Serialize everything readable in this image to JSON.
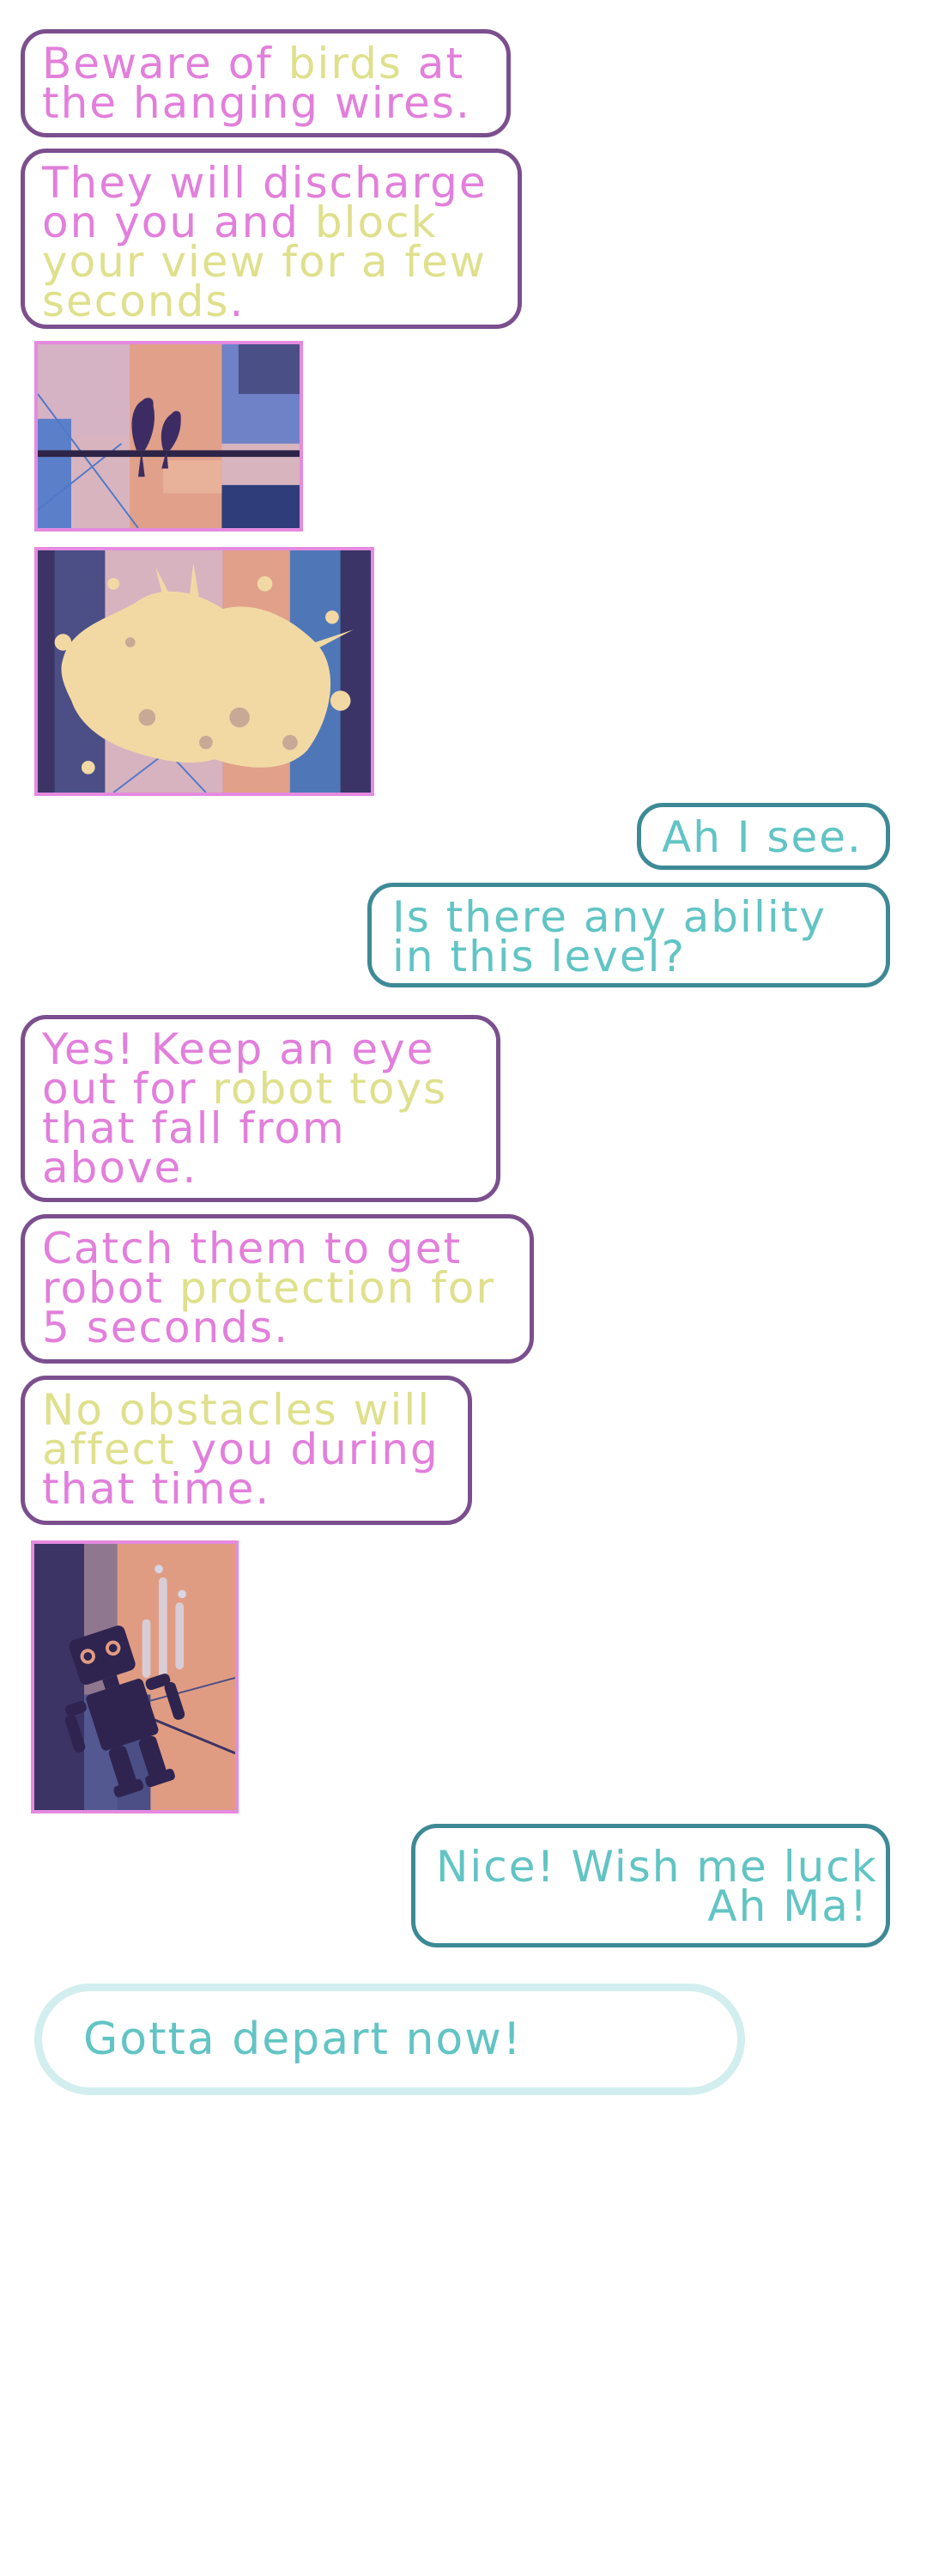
{
  "conversation": {
    "mom_1": {
      "seg1": "Beware of ",
      "seg2": "birds",
      "seg3": " at",
      "seg4": "the hanging wires."
    },
    "mom_2": {
      "seg1": "They will discharge",
      "seg2": "on you and ",
      "seg3": "block",
      "seg4": "your view for a few",
      "seg5": "seconds",
      "seg6": "."
    },
    "image_1": {
      "icon": "birds-on-wire-illustration"
    },
    "image_2": {
      "icon": "bird-dropping-splat-illustration"
    },
    "me_1": {
      "line1": "Ah I see."
    },
    "me_2": {
      "line1": "Is there any ability",
      "line2": "in this level?"
    },
    "mom_3": {
      "seg1": "Yes! Keep an eye",
      "seg2": "out for ",
      "seg3": "robot toys",
      "seg4": "that fall from",
      "seg5": "above."
    },
    "mom_4": {
      "seg1": "Catch them to get",
      "seg2": "robot ",
      "seg3": "protection for",
      "seg4": "5 seconds."
    },
    "mom_5": {
      "seg1": "No obstacles will",
      "seg2": "affect ",
      "seg3": "you during",
      "seg4": "that time."
    },
    "image_3": {
      "icon": "falling-robot-toy-illustration"
    },
    "me_3": {
      "line1": "Nice! Wish me luck",
      "line2": "Ah Ma!"
    }
  },
  "reply_option": {
    "label": "Gotta depart now!"
  },
  "colors": {
    "mom_border": "#7b4f8e",
    "mom_text_pink": "#e27fdb",
    "mom_text_yellow": "#dfe08c",
    "me_border": "#3d8a96",
    "me_text": "#62c4c4",
    "image_border": "#e58ae0",
    "reply_border": "#d3eeee"
  }
}
